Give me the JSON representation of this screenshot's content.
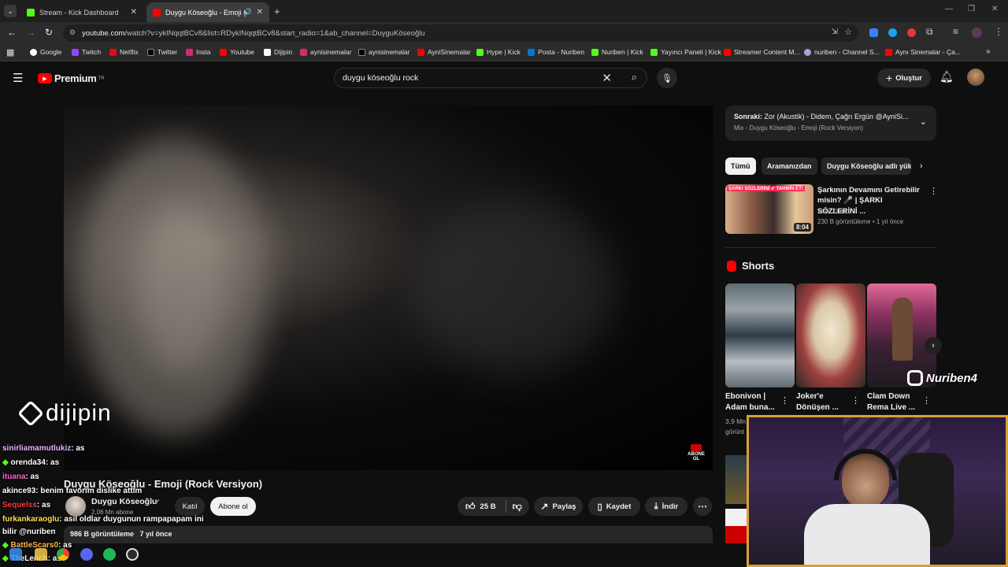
{
  "browser": {
    "tabs": [
      {
        "title": "Stream - Kick Dashboard",
        "active": false
      },
      {
        "title": "Duygu Köseoğlu - Emoji (R",
        "active": true
      }
    ],
    "url_host": "youtube.com",
    "url_rest": "/watch?v=ykINqqtBCv8&list=RDykINqqtBCv8&start_radio=1&ab_channel=DuyguKöseoğlu",
    "bookmarks": [
      "Google",
      "Twitch",
      "Netflix",
      "Twitter",
      "Insta",
      "Youtube",
      "Dijipin",
      "aynisinemalar",
      "aynisinemalar",
      "AyniSinemalar",
      "Hype | Kick",
      "Posta - Nuriben",
      "Nuriben | Kick",
      "Yayıncı Paneli | Kick",
      "Streamer Content M...",
      "nuriben - Channel S...",
      "Aynı Sinemalar - Ça..."
    ]
  },
  "youtube": {
    "logo_text": "Premium",
    "logo_sup": "TR",
    "search_value": "duygu köseoğlu rock",
    "create_label": "Oluştur",
    "video_title": "Duygu Köseoğlu - Emoji (Rock Versiyon)",
    "channel_name": "Duygu Köseoğlu",
    "subscribers": "2,06 Mn abone",
    "join_label": "Katıl",
    "subscribe_label": "Abone ol",
    "likes": "25 B",
    "share_label": "Paylaş",
    "save_label": "Kaydet",
    "download_label": "İndir",
    "views": "986 B görüntüleme",
    "age": "7 yıl önce",
    "watermark": "dijipin",
    "abone_badge": "ABONE OL"
  },
  "sidebar": {
    "next_label": "Sonraki:",
    "next_title": "Zor (Akustik) - Didem, Çağrı Ergün @AyniSi...",
    "next_sub": "Mix - Duygu Köseoğlu - Emoji (Rock Versiyon)",
    "chips": [
      "Tümü",
      "Aramanızdan",
      "Duygu Köseoğlu adlı yük"
    ],
    "rec_title": "Şarkının Devamını Getirebilir misin? 🎤 | ŞARKI SÖZLERİNİ ...",
    "rec_channel": "Türk Zillaz",
    "rec_meta": "230 B görüntüleme • 1 yıl önce",
    "rec_duration": "8:04",
    "rec_thumb_text": "ŞARKI SÖZLERİNİ ✔ TAHMİN ET!",
    "shorts_heading": "Shorts",
    "shorts": [
      {
        "title": "Ebonivon | Adam buna..."
      },
      {
        "title": "Joker'e Dönüşen ..."
      },
      {
        "title": "Clam Down Rema Live ..."
      }
    ],
    "shorts_meta_partial": "3,9 Mn",
    "shorts_meta_partial2": "görünt",
    "overlay_brand": "Nuriben4"
  },
  "chat": [
    {
      "user": "sinirliamamutlukiz",
      "color": "#e9b3ff",
      "msg": ": as"
    },
    {
      "user": "orenda34",
      "color": "#ffffff",
      "msg": ": as"
    },
    {
      "user": "ituana",
      "color": "#ff66cc",
      "msg": ": as"
    },
    {
      "user": "akince93",
      "color": "#ffffff",
      "msg": ": benim favorim dislike attım"
    },
    {
      "user": "Sequelss",
      "color": "#ff3b3b",
      "msg": ": as"
    },
    {
      "user": "furkankaraoglu",
      "color": "#ffe04d",
      "msg": ": asil oldlar duygunun rampapapam ini"
    },
    {
      "user": "",
      "color": "#ffffff",
      "msg": "bilir @nuriben"
    },
    {
      "user": "BattleScars0",
      "color": "#ffb347",
      "msg": ": as"
    },
    {
      "user": "TheLench",
      "color": "#ffffff",
      "msg": ": as"
    }
  ],
  "colors": {
    "youtube_red": "#ff0000",
    "kick_green": "#53fc18",
    "webcam_border": "#d9a13a"
  }
}
